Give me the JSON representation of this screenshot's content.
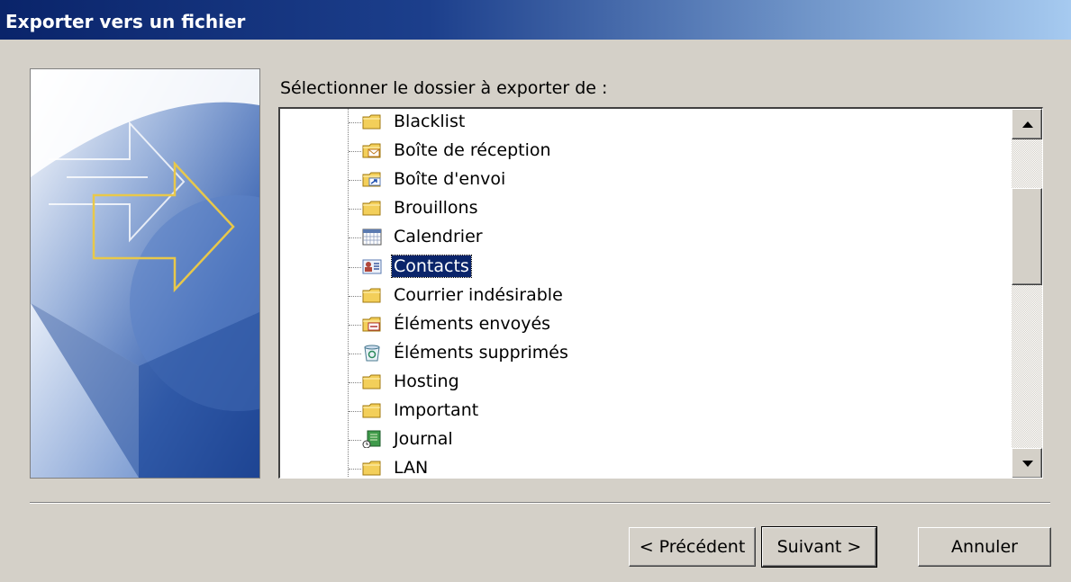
{
  "window": {
    "title": "Exporter vers un fichier"
  },
  "prompt": "Sélectionner le dossier à exporter de :",
  "folders": [
    {
      "label": "Blacklist",
      "icon": "folder-icon"
    },
    {
      "label": "Boîte de réception",
      "icon": "inbox-icon"
    },
    {
      "label": "Boîte d'envoi",
      "icon": "outbox-icon"
    },
    {
      "label": "Brouillons",
      "icon": "folder-icon"
    },
    {
      "label": "Calendrier",
      "icon": "calendar-icon"
    },
    {
      "label": "Contacts",
      "icon": "contacts-icon",
      "selected": true
    },
    {
      "label": "Courrier indésirable",
      "icon": "folder-icon"
    },
    {
      "label": "Éléments envoyés",
      "icon": "sent-items-icon"
    },
    {
      "label": "Éléments supprimés",
      "icon": "deleted-items-icon"
    },
    {
      "label": "Hosting",
      "icon": "folder-icon"
    },
    {
      "label": "Important",
      "icon": "folder-icon"
    },
    {
      "label": "Journal",
      "icon": "journal-icon"
    },
    {
      "label": "LAN",
      "icon": "folder-icon"
    }
  ],
  "buttons": {
    "previous": "< Précédent",
    "next": "Suivant >",
    "cancel": "Annuler"
  },
  "colors": {
    "title_bar": "#0a246a",
    "selection": "#0a246a",
    "dialog_bg": "#d4d0c8"
  }
}
